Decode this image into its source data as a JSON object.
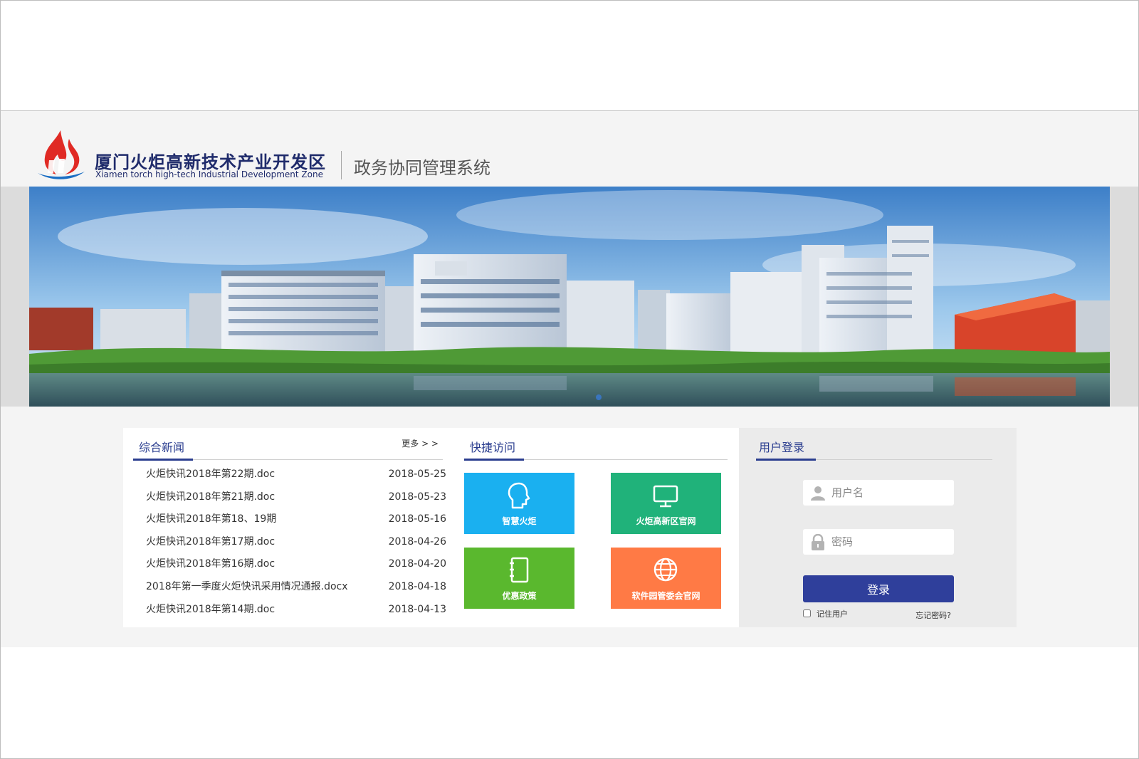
{
  "header": {
    "org_name_cn": "厦门火炬高新技术产业开发区",
    "org_name_en": "Xiamen torch high-tech Industrial Development Zone",
    "system_title": "政务协同管理系统"
  },
  "news": {
    "title": "综合新闻",
    "more_label": "更多 > >",
    "items": [
      {
        "title": "火炬快讯2018年第22期.doc",
        "date": "2018-05-25"
      },
      {
        "title": "火炬快讯2018年第21期.doc",
        "date": "2018-05-23"
      },
      {
        "title": "火炬快讯2018年第18、19期",
        "date": "2018-05-16"
      },
      {
        "title": "火炬快讯2018年第17期.doc",
        "date": "2018-04-26"
      },
      {
        "title": "火炬快讯2018年第16期.doc",
        "date": "2018-04-20"
      },
      {
        "title": "2018年第一季度火炬快讯采用情况通报.docx",
        "date": "2018-04-18"
      },
      {
        "title": "火炬快讯2018年第14期.doc",
        "date": "2018-04-13"
      }
    ]
  },
  "quick_access": {
    "title": "快捷访问",
    "tiles": [
      {
        "label": "智慧火炬",
        "icon": "head-icon",
        "color": "#1ab0f0"
      },
      {
        "label": "火炬高新区官网",
        "icon": "monitor-icon",
        "color": "#20b27a"
      },
      {
        "label": "优惠政策",
        "icon": "notebook-icon",
        "color": "#5ab82e"
      },
      {
        "label": "软件园管委会官网",
        "icon": "globe-icon",
        "color": "#ff7a45"
      }
    ]
  },
  "login": {
    "title": "用户登录",
    "username_placeholder": "用户名",
    "password_placeholder": "密码",
    "submit_label": "登录",
    "remember_label": "记住用户",
    "forgot_label": "忘记密码?"
  },
  "colors": {
    "accent": "#2a3d8f",
    "login_button": "#2f3f9b",
    "logo_red": "#e02a24",
    "logo_blue": "#1c6fc4"
  }
}
